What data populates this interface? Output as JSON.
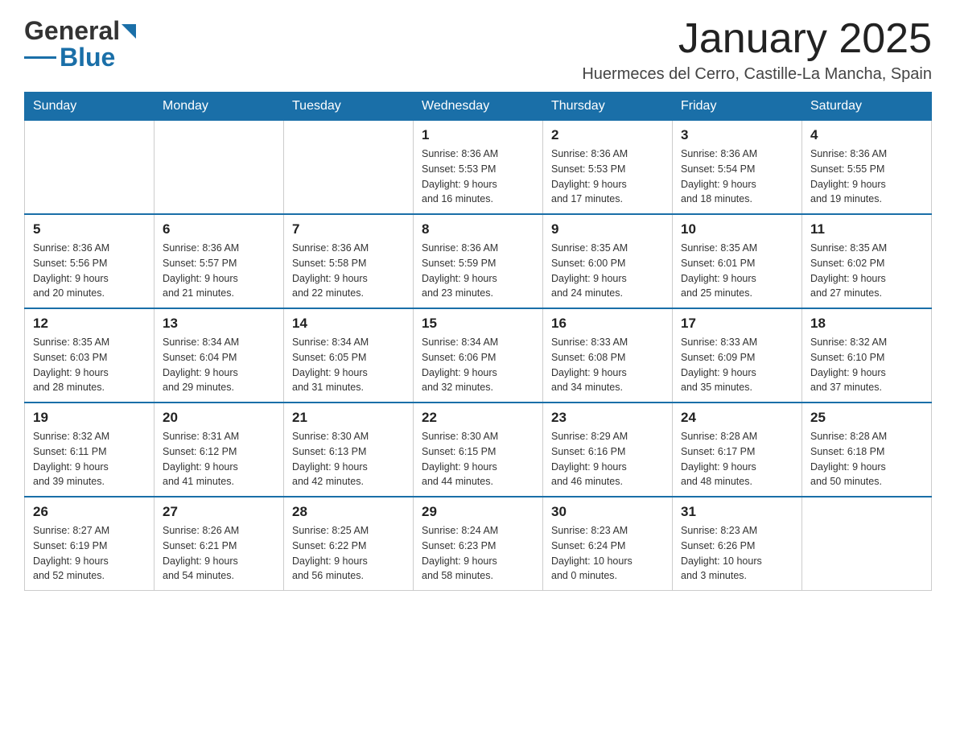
{
  "header": {
    "logo_general": "General",
    "logo_blue": "Blue",
    "month_title": "January 2025",
    "location": "Huermeces del Cerro, Castille-La Mancha, Spain"
  },
  "days_of_week": [
    "Sunday",
    "Monday",
    "Tuesday",
    "Wednesday",
    "Thursday",
    "Friday",
    "Saturday"
  ],
  "weeks": [
    [
      {
        "day": "",
        "info": ""
      },
      {
        "day": "",
        "info": ""
      },
      {
        "day": "",
        "info": ""
      },
      {
        "day": "1",
        "info": "Sunrise: 8:36 AM\nSunset: 5:53 PM\nDaylight: 9 hours\nand 16 minutes."
      },
      {
        "day": "2",
        "info": "Sunrise: 8:36 AM\nSunset: 5:53 PM\nDaylight: 9 hours\nand 17 minutes."
      },
      {
        "day": "3",
        "info": "Sunrise: 8:36 AM\nSunset: 5:54 PM\nDaylight: 9 hours\nand 18 minutes."
      },
      {
        "day": "4",
        "info": "Sunrise: 8:36 AM\nSunset: 5:55 PM\nDaylight: 9 hours\nand 19 minutes."
      }
    ],
    [
      {
        "day": "5",
        "info": "Sunrise: 8:36 AM\nSunset: 5:56 PM\nDaylight: 9 hours\nand 20 minutes."
      },
      {
        "day": "6",
        "info": "Sunrise: 8:36 AM\nSunset: 5:57 PM\nDaylight: 9 hours\nand 21 minutes."
      },
      {
        "day": "7",
        "info": "Sunrise: 8:36 AM\nSunset: 5:58 PM\nDaylight: 9 hours\nand 22 minutes."
      },
      {
        "day": "8",
        "info": "Sunrise: 8:36 AM\nSunset: 5:59 PM\nDaylight: 9 hours\nand 23 minutes."
      },
      {
        "day": "9",
        "info": "Sunrise: 8:35 AM\nSunset: 6:00 PM\nDaylight: 9 hours\nand 24 minutes."
      },
      {
        "day": "10",
        "info": "Sunrise: 8:35 AM\nSunset: 6:01 PM\nDaylight: 9 hours\nand 25 minutes."
      },
      {
        "day": "11",
        "info": "Sunrise: 8:35 AM\nSunset: 6:02 PM\nDaylight: 9 hours\nand 27 minutes."
      }
    ],
    [
      {
        "day": "12",
        "info": "Sunrise: 8:35 AM\nSunset: 6:03 PM\nDaylight: 9 hours\nand 28 minutes."
      },
      {
        "day": "13",
        "info": "Sunrise: 8:34 AM\nSunset: 6:04 PM\nDaylight: 9 hours\nand 29 minutes."
      },
      {
        "day": "14",
        "info": "Sunrise: 8:34 AM\nSunset: 6:05 PM\nDaylight: 9 hours\nand 31 minutes."
      },
      {
        "day": "15",
        "info": "Sunrise: 8:34 AM\nSunset: 6:06 PM\nDaylight: 9 hours\nand 32 minutes."
      },
      {
        "day": "16",
        "info": "Sunrise: 8:33 AM\nSunset: 6:08 PM\nDaylight: 9 hours\nand 34 minutes."
      },
      {
        "day": "17",
        "info": "Sunrise: 8:33 AM\nSunset: 6:09 PM\nDaylight: 9 hours\nand 35 minutes."
      },
      {
        "day": "18",
        "info": "Sunrise: 8:32 AM\nSunset: 6:10 PM\nDaylight: 9 hours\nand 37 minutes."
      }
    ],
    [
      {
        "day": "19",
        "info": "Sunrise: 8:32 AM\nSunset: 6:11 PM\nDaylight: 9 hours\nand 39 minutes."
      },
      {
        "day": "20",
        "info": "Sunrise: 8:31 AM\nSunset: 6:12 PM\nDaylight: 9 hours\nand 41 minutes."
      },
      {
        "day": "21",
        "info": "Sunrise: 8:30 AM\nSunset: 6:13 PM\nDaylight: 9 hours\nand 42 minutes."
      },
      {
        "day": "22",
        "info": "Sunrise: 8:30 AM\nSunset: 6:15 PM\nDaylight: 9 hours\nand 44 minutes."
      },
      {
        "day": "23",
        "info": "Sunrise: 8:29 AM\nSunset: 6:16 PM\nDaylight: 9 hours\nand 46 minutes."
      },
      {
        "day": "24",
        "info": "Sunrise: 8:28 AM\nSunset: 6:17 PM\nDaylight: 9 hours\nand 48 minutes."
      },
      {
        "day": "25",
        "info": "Sunrise: 8:28 AM\nSunset: 6:18 PM\nDaylight: 9 hours\nand 50 minutes."
      }
    ],
    [
      {
        "day": "26",
        "info": "Sunrise: 8:27 AM\nSunset: 6:19 PM\nDaylight: 9 hours\nand 52 minutes."
      },
      {
        "day": "27",
        "info": "Sunrise: 8:26 AM\nSunset: 6:21 PM\nDaylight: 9 hours\nand 54 minutes."
      },
      {
        "day": "28",
        "info": "Sunrise: 8:25 AM\nSunset: 6:22 PM\nDaylight: 9 hours\nand 56 minutes."
      },
      {
        "day": "29",
        "info": "Sunrise: 8:24 AM\nSunset: 6:23 PM\nDaylight: 9 hours\nand 58 minutes."
      },
      {
        "day": "30",
        "info": "Sunrise: 8:23 AM\nSunset: 6:24 PM\nDaylight: 10 hours\nand 0 minutes."
      },
      {
        "day": "31",
        "info": "Sunrise: 8:23 AM\nSunset: 6:26 PM\nDaylight: 10 hours\nand 3 minutes."
      },
      {
        "day": "",
        "info": ""
      }
    ]
  ]
}
